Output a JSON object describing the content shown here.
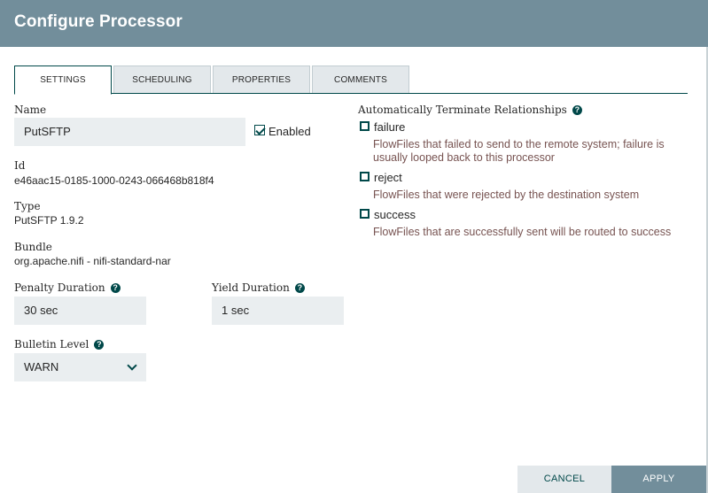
{
  "dialog": {
    "title": "Configure Processor"
  },
  "tabs": [
    {
      "label": "SETTINGS",
      "active": true
    },
    {
      "label": "SCHEDULING",
      "active": false
    },
    {
      "label": "PROPERTIES",
      "active": false
    },
    {
      "label": "COMMENTS",
      "active": false
    }
  ],
  "settings": {
    "name_label": "Name",
    "name_value": "PutSFTP",
    "enabled_label": "Enabled",
    "enabled_checked": true,
    "id_label": "Id",
    "id_value": "e46aac15-0185-1000-0243-066468b818f4",
    "type_label": "Type",
    "type_value": "PutSFTP 1.9.2",
    "bundle_label": "Bundle",
    "bundle_value": "org.apache.nifi - nifi-standard-nar",
    "penalty_label": "Penalty Duration",
    "penalty_value": "30 sec",
    "yield_label": "Yield Duration",
    "yield_value": "1 sec",
    "bulletin_label": "Bulletin Level",
    "bulletin_value": "WARN"
  },
  "relationships": {
    "heading": "Automatically Terminate Relationships",
    "items": [
      {
        "name": "failure",
        "checked": false,
        "description": "FlowFiles that failed to send to the remote system; failure is usually looped back to this processor"
      },
      {
        "name": "reject",
        "checked": false,
        "description": "FlowFiles that were rejected by the destination system"
      },
      {
        "name": "success",
        "checked": false,
        "description": "FlowFiles that are successfully sent will be routed to success"
      }
    ]
  },
  "footer": {
    "cancel_label": "CANCEL",
    "apply_label": "APPLY"
  },
  "icons": {
    "help": "help-icon",
    "check": "check-icon",
    "chevron": "chevron-down-icon"
  },
  "colors": {
    "header": "#728e9b",
    "accent": "#004849",
    "input_bg": "#eaeef0",
    "description": "#775351"
  }
}
